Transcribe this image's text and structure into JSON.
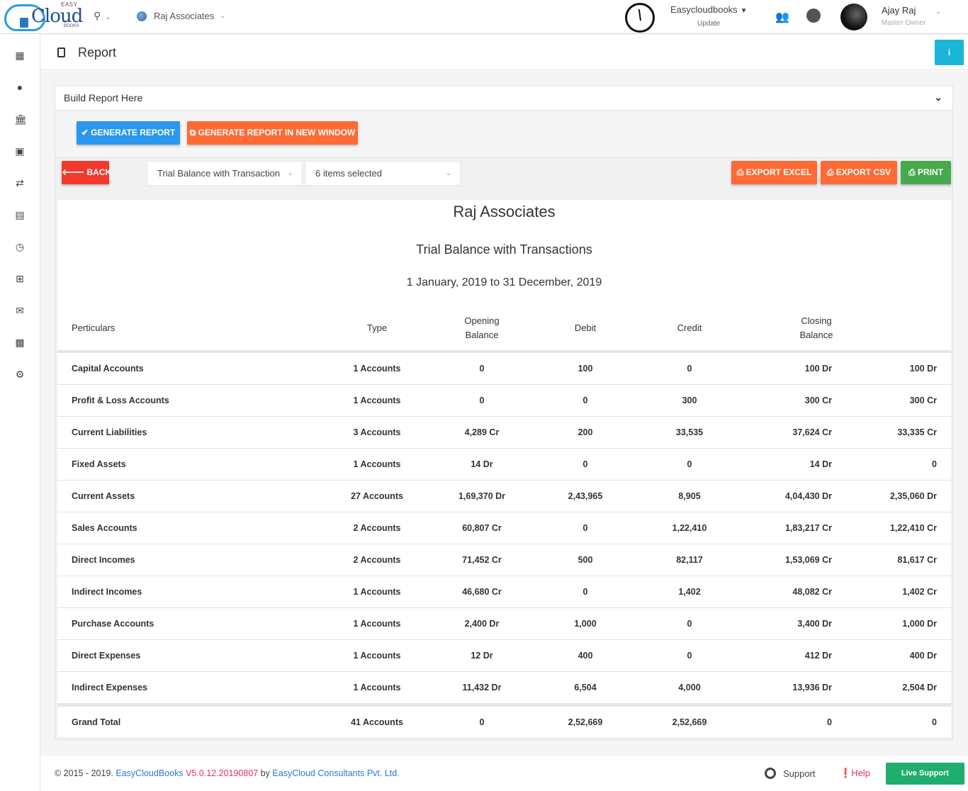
{
  "topbar": {
    "logo_easy": "EASY",
    "logo_cloud": "Cloud",
    "logo_books": "BOOKS",
    "company": "Raj Associates",
    "org_name": "Easycloudbooks",
    "org_update": "Update",
    "user_name": "Ajay Raj",
    "user_role": "Master Owner"
  },
  "page": {
    "title": "Report",
    "info_label": "i"
  },
  "builder": {
    "label": "Build Report Here",
    "generate_label": "✔ GENERATE REPORT",
    "generate_new_label": "⧉ GENERATE REPORT IN NEW WINDOW"
  },
  "toolbar": {
    "back_label": "🡐 BACK",
    "report_type": "Trial Balance with Transaction",
    "items_selected": "6 items selected",
    "export_excel": "⎙ EXPORT EXCEL",
    "export_csv": "⎙ EXPORT CSV",
    "print": "⎙ PRINT"
  },
  "report": {
    "company": "Raj Associates",
    "title": "Trial Balance with Transactions",
    "period": "1 January, 2019 to 31 December, 2019",
    "headers": {
      "particulars": "Perticulars",
      "type": "Type",
      "opening_1": "Opening",
      "opening_2": "Balance",
      "debit": "Debit",
      "credit": "Credit",
      "closing_1": "Closing",
      "closing_2": "Balance"
    },
    "rows": [
      {
        "name": "Capital Accounts",
        "type": "1 Accounts",
        "opening": "0",
        "debit": "100",
        "credit": "0",
        "closing": "100 Dr",
        "net": "100 Dr"
      },
      {
        "name": "Profit & Loss Accounts",
        "type": "1 Accounts",
        "opening": "0",
        "debit": "0",
        "credit": "300",
        "closing": "300 Cr",
        "net": "300 Cr"
      },
      {
        "name": "Current Liabilities",
        "type": "3 Accounts",
        "opening": "4,289 Cr",
        "debit": "200",
        "credit": "33,535",
        "closing": "37,624 Cr",
        "net": "33,335 Cr"
      },
      {
        "name": "Fixed Assets",
        "type": "1 Accounts",
        "opening": "14 Dr",
        "debit": "0",
        "credit": "0",
        "closing": "14 Dr",
        "net": "0"
      },
      {
        "name": "Current Assets",
        "type": "27 Accounts",
        "opening": "1,69,370 Dr",
        "debit": "2,43,965",
        "credit": "8,905",
        "closing": "4,04,430 Dr",
        "net": "2,35,060 Dr"
      },
      {
        "name": "Sales Accounts",
        "type": "2 Accounts",
        "opening": "60,807 Cr",
        "debit": "0",
        "credit": "1,22,410",
        "closing": "1,83,217 Cr",
        "net": "1,22,410 Cr"
      },
      {
        "name": "Direct Incomes",
        "type": "2 Accounts",
        "opening": "71,452 Cr",
        "debit": "500",
        "credit": "82,117",
        "closing": "1,53,069 Cr",
        "net": "81,617 Cr"
      },
      {
        "name": "Indirect Incomes",
        "type": "1 Accounts",
        "opening": "46,680 Cr",
        "debit": "0",
        "credit": "1,402",
        "closing": "48,082 Cr",
        "net": "1,402 Cr"
      },
      {
        "name": "Purchase Accounts",
        "type": "1 Accounts",
        "opening": "2,400 Dr",
        "debit": "1,000",
        "credit": "0",
        "closing": "3,400 Dr",
        "net": "1,000 Dr"
      },
      {
        "name": "Direct Expenses",
        "type": "1 Accounts",
        "opening": "12 Dr",
        "debit": "400",
        "credit": "0",
        "closing": "412 Dr",
        "net": "400 Dr"
      },
      {
        "name": "Indirect Expenses",
        "type": "1 Accounts",
        "opening": "11,432 Dr",
        "debit": "6,504",
        "credit": "4,000",
        "closing": "13,936 Dr",
        "net": "2,504 Dr"
      }
    ],
    "total": {
      "name": "Grand Total",
      "type": "41 Accounts",
      "opening": "0",
      "debit": "2,52,669",
      "credit": "2,52,669",
      "closing": "0",
      "net": "0"
    }
  },
  "footer": {
    "copyright": "© 2015 - 2019.",
    "product": "EasyCloudBooks",
    "version": "V5.0.12.20190807",
    "by": "by",
    "company": "EasyCloud Consultants Pvt. Ltd.",
    "support": "Support",
    "help": "Help",
    "live_support": "Live Support"
  },
  "colors": {
    "accent_blue": "#2b97ee",
    "accent_orange": "#ff6a35",
    "accent_red": "#f2392e",
    "accent_green": "#46a94b",
    "info_cyan": "#1cb5d8",
    "live_green": "#1fae6e"
  }
}
